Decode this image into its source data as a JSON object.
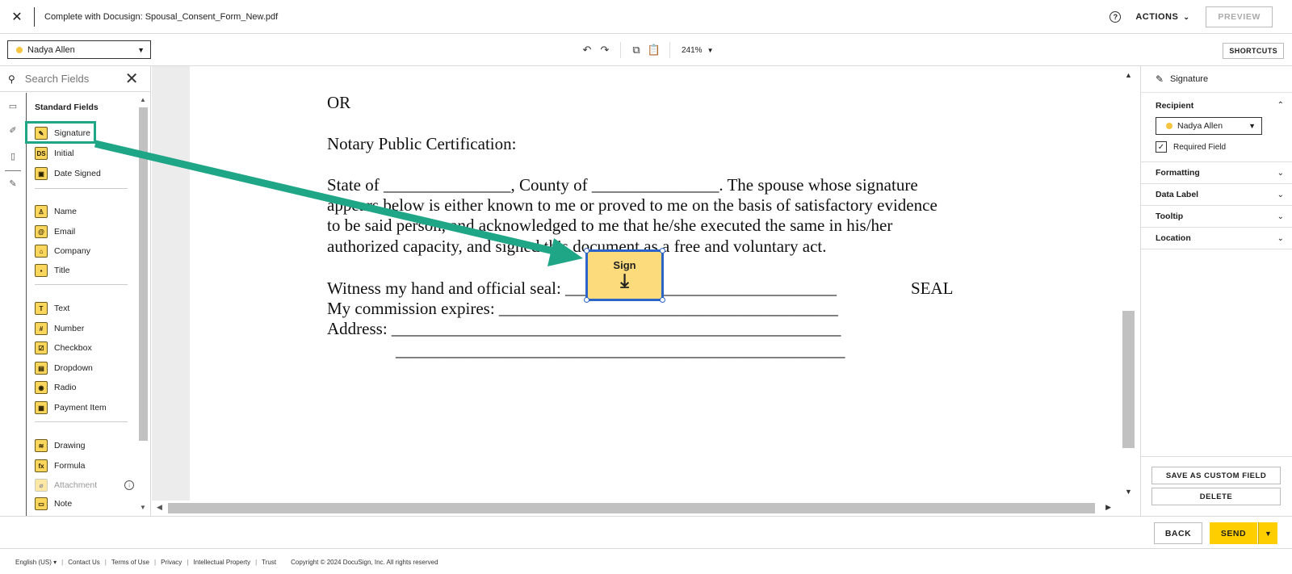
{
  "header": {
    "title": "Complete with Docusign: Spousal_Consent_Form_New.pdf",
    "actions_label": "ACTIONS",
    "preview_label": "PREVIEW"
  },
  "toolbar": {
    "recipient": "Nadya Allen",
    "zoom": "241%",
    "shortcuts_label": "SHORTCUTS"
  },
  "left_panel": {
    "search_placeholder": "Search Fields",
    "heading": "Standard Fields",
    "fields": [
      {
        "label": "Signature",
        "icon": "pen-icon",
        "glyph": "✎"
      },
      {
        "label": "Initial",
        "icon": "initial-icon",
        "glyph": "DS"
      },
      {
        "label": "Date Signed",
        "icon": "calendar-icon",
        "glyph": "▣"
      },
      {
        "label": "Name",
        "icon": "person-icon",
        "glyph": "♙"
      },
      {
        "label": "Email",
        "icon": "at-icon",
        "glyph": "@"
      },
      {
        "label": "Company",
        "icon": "building-icon",
        "glyph": "⌂"
      },
      {
        "label": "Title",
        "icon": "briefcase-icon",
        "glyph": "▪"
      },
      {
        "label": "Text",
        "icon": "text-icon",
        "glyph": "T"
      },
      {
        "label": "Number",
        "icon": "hash-icon",
        "glyph": "#"
      },
      {
        "label": "Checkbox",
        "icon": "checkbox-icon",
        "glyph": "☑"
      },
      {
        "label": "Dropdown",
        "icon": "dropdown-icon",
        "glyph": "▤"
      },
      {
        "label": "Radio",
        "icon": "radio-icon",
        "glyph": "◉"
      },
      {
        "label": "Payment Item",
        "icon": "payment-icon",
        "glyph": "▦"
      },
      {
        "label": "Drawing",
        "icon": "drawing-icon",
        "glyph": "≋"
      },
      {
        "label": "Formula",
        "icon": "formula-icon",
        "glyph": "fx"
      },
      {
        "label": "Attachment",
        "icon": "paperclip-icon",
        "glyph": "⌀"
      },
      {
        "label": "Note",
        "icon": "note-icon",
        "glyph": "▭"
      }
    ]
  },
  "document": {
    "lines": [
      "OR",
      "Notary Public Certification:",
      "State of _______________, County of _______________. The spouse whose signature",
      "appears below is either known to me or proved to me on the basis of satisfactory evidence",
      "to be said person, and acknowledged to me that he/she executed the same in his/her",
      "authorized capacity, and signed this document as a free and voluntary act.",
      "Witness my hand and official seal: ________________________________",
      "My commission expires: ________________________________________",
      "Address: _____________________________________________________",
      "_____________________________________________________"
    ],
    "seal": "SEAL",
    "sign_field_label": "Sign"
  },
  "right_panel": {
    "title": "Signature",
    "recipient_header": "Recipient",
    "recipient": "Nadya Allen",
    "required_label": "Required Field",
    "sections": [
      "Formatting",
      "Data Label",
      "Tooltip",
      "Location"
    ],
    "save_custom_label": "SAVE AS CUSTOM FIELD",
    "delete_label": "DELETE"
  },
  "bottom": {
    "back_label": "BACK",
    "send_label": "SEND"
  },
  "footer": {
    "language": "English (US) ▾",
    "links": [
      "Contact Us",
      "Terms of Use",
      "Privacy",
      "Intellectual Property",
      "Trust"
    ],
    "copyright": "Copyright © 2024 DocuSign, Inc. All rights reserved"
  },
  "colors": {
    "accent_yellow": "#ffce00",
    "field_yellow": "#fbd65c",
    "annotation_green": "#1ea687",
    "selection_blue": "#2d64c8"
  }
}
